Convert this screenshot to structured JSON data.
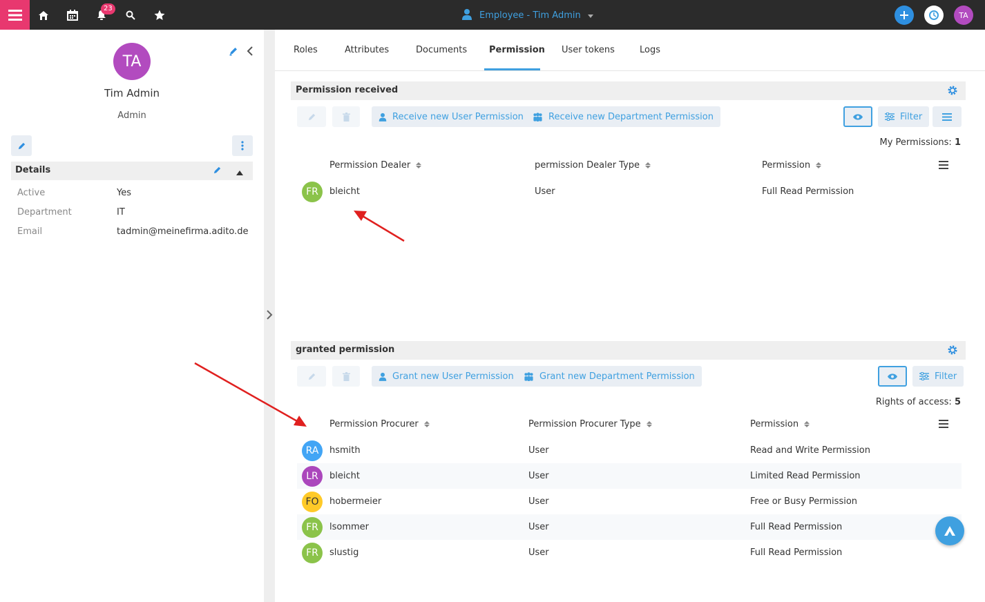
{
  "topbar": {
    "notification_count": "23",
    "context_title": "Employee - Tim Admin",
    "user_initials": "TA",
    "icons": [
      "menu-icon",
      "home-icon",
      "calendar-icon",
      "bell-icon",
      "search-icon",
      "star-icon",
      "user-icon",
      "caret-down-icon",
      "plus-icon",
      "history-icon"
    ]
  },
  "profile": {
    "initials": "TA",
    "name": "Tim Admin",
    "role": "Admin",
    "avatar_color": "#b24bbf"
  },
  "details": {
    "title": "Details",
    "rows": [
      {
        "label": "Active",
        "value": "Yes"
      },
      {
        "label": "Department",
        "value": "IT"
      },
      {
        "label": "Email",
        "value": "tadmin@meinefirma.adito.de"
      }
    ]
  },
  "tabs": [
    {
      "label": "Roles"
    },
    {
      "label": "Attributes"
    },
    {
      "label": "Documents"
    },
    {
      "label": "Permission",
      "active": true
    },
    {
      "label": "User tokens"
    },
    {
      "label": "Logs"
    }
  ],
  "received": {
    "title": "Permission received",
    "btn_user": "Receive new User Permission",
    "btn_dept": "Receive new Department Permission",
    "btn_filter": "Filter",
    "count_label": "My Permissions:",
    "count_value": "1",
    "columns": [
      "Permission Dealer",
      "permission Dealer Type",
      "Permission"
    ],
    "rows": [
      {
        "initials": "FR",
        "color": "#8bc34a",
        "name": "bleicht",
        "type": "User",
        "permission": "Full Read Permission"
      }
    ]
  },
  "granted": {
    "title": "granted permission",
    "btn_user": "Grant new User Permission",
    "btn_dept": "Grant new Department Permission",
    "btn_filter": "Filter",
    "count_label": "Rights of access:",
    "count_value": "5",
    "columns": [
      "Permission Procurer",
      "Permission Procurer Type",
      "Permission"
    ],
    "rows": [
      {
        "initials": "RA",
        "color": "#42a5f5",
        "name": "hsmith",
        "type": "User",
        "permission": "Read and Write Permission"
      },
      {
        "initials": "LR",
        "color": "#ab47bc",
        "name": "bleicht",
        "type": "User",
        "permission": "Limited Read Permission"
      },
      {
        "initials": "FO",
        "color": "#ffca28",
        "name": "hobermeier",
        "type": "User",
        "permission": "Free or Busy Permission"
      },
      {
        "initials": "FR",
        "color": "#8bc34a",
        "name": "lsommer",
        "type": "User",
        "permission": "Full Read Permission"
      },
      {
        "initials": "FR",
        "color": "#8bc34a",
        "name": "slustig",
        "type": "User",
        "permission": "Full Read Permission"
      }
    ]
  },
  "colors": {
    "accent": "#3fa0e0",
    "brand": "#e8386f",
    "topbar": "#2b2b2b",
    "annotation_arrow": "#e0201f"
  }
}
